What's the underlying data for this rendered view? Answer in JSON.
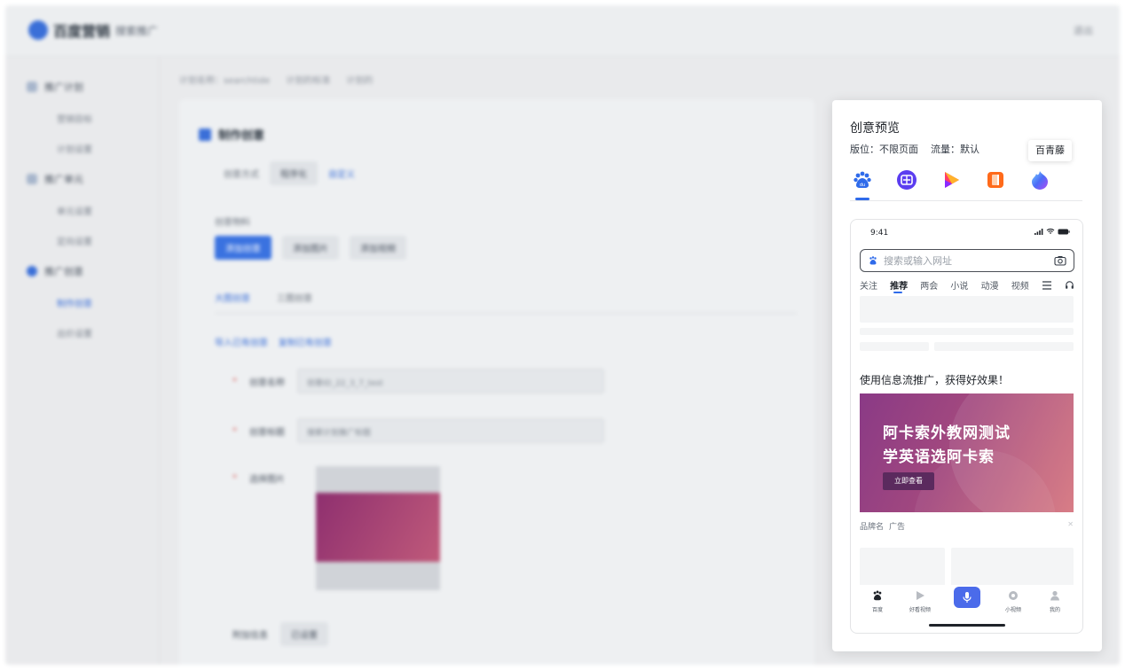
{
  "background_app": {
    "brand": "百度营销",
    "brand_sub": "搜索推广",
    "logout": "退出",
    "sidebar": {
      "items": [
        {
          "label": "推广计划"
        },
        {
          "label": "推广单元"
        },
        {
          "label": "推广创意"
        }
      ],
      "subs": [
        {
          "label": "营销目标"
        },
        {
          "label": "计划设置"
        },
        {
          "label": "单元设置"
        },
        {
          "label": "定向设置"
        },
        {
          "label": "制作创意"
        },
        {
          "label": "出价设置"
        }
      ]
    },
    "breadcrumbs": [
      "计划名称：searchtide",
      "计划的标准",
      "计划的"
    ],
    "panel": {
      "title": "制作创意",
      "mode_label": "创意方式",
      "mode_value": "程序化",
      "mode_link": "自定义",
      "material_label": "创意物料",
      "buttons": [
        "添加创意",
        "添加图片",
        "添加视频"
      ],
      "tabs": [
        "大图创意",
        "三图创意"
      ],
      "tools": [
        "导入已有创意",
        "复制已有创意"
      ],
      "fields": [
        {
          "label": "创意名称",
          "value": "创意ID_22_3_7_test"
        },
        {
          "label": "创意标题",
          "value": "搜索计划推广标题"
        },
        {
          "label": "选择图片",
          "value": ""
        }
      ],
      "extra_label": "附加信息",
      "extra_value": "已设置"
    }
  },
  "preview": {
    "title": "创意预览",
    "placement_label": "版位：",
    "placement_value": "不限页面",
    "traffic_label": "流量：",
    "traffic_value": "默认",
    "tooltip": "百青藤",
    "apps": [
      {
        "icon": "baidu-paw-icon",
        "color": "#2f6bea"
      },
      {
        "icon": "tieba-icon",
        "color": "#5b3df0"
      },
      {
        "icon": "haokan-video-icon",
        "color": "#ff6a2b"
      },
      {
        "icon": "novel-icon",
        "color": "#ff6a1a"
      },
      {
        "icon": "baiqingteng-icon",
        "color": "#4a6cf7"
      }
    ],
    "phone": {
      "time": "9:41",
      "search_placeholder": "搜索或输入网址",
      "nav": [
        "关注",
        "推荐",
        "两会",
        "小说",
        "动漫",
        "视频"
      ],
      "ad_title": "使用信息流推广，获得好效果！",
      "banner_line1": "阿卡索外教网测试",
      "banner_line2": "学英语选阿卡索",
      "banner_button": "立即查看",
      "brand_name": "品牌名",
      "ad_tag": "广告",
      "tabbar": [
        "百度",
        "好看视频",
        "小视频",
        "我的"
      ]
    }
  }
}
